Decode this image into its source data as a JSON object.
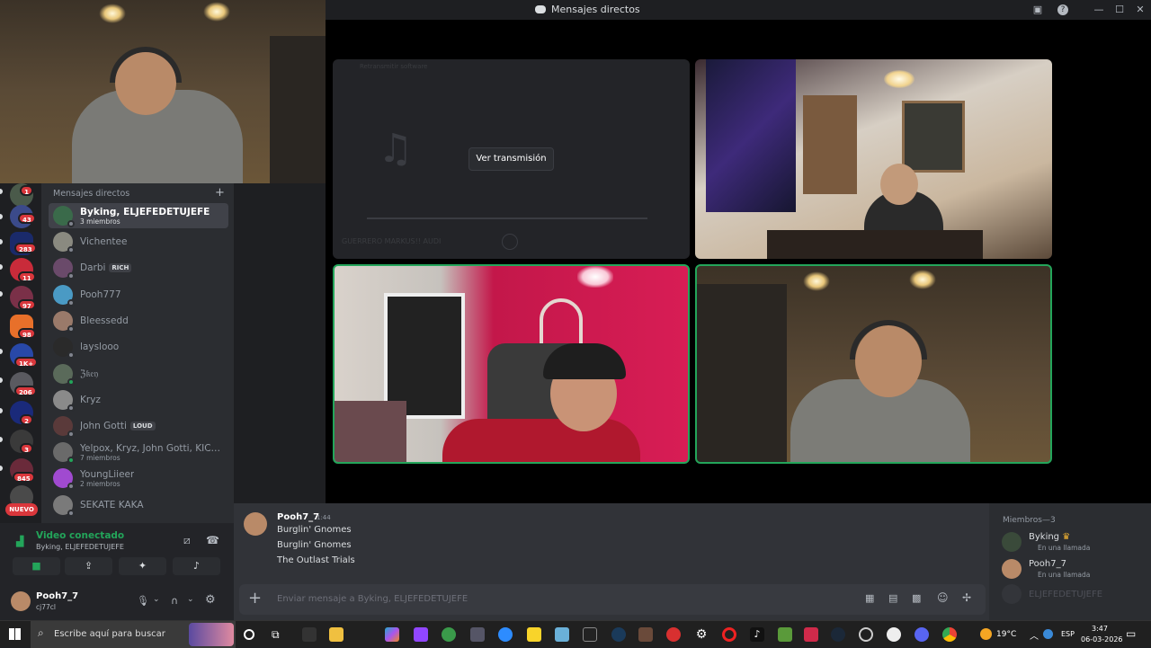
{
  "window": {
    "title": "Mensajes directos"
  },
  "stage": {
    "stream_button": "Ver transmisión",
    "stream_track": "GUERRERO MARKUS!! AUDI",
    "stream_channel": "Retransmitir software"
  },
  "servers": {
    "badges": [
      "1",
      "43",
      "283",
      "11",
      "97",
      "98",
      "1K+",
      "206",
      "2",
      "3",
      "845"
    ],
    "new_label": "NUEVO"
  },
  "dm": {
    "header": "Mensajes directos",
    "items": [
      {
        "name": "Byking, ELJEFEDETUJEFE",
        "sub": "3 miembros",
        "active": true
      },
      {
        "name": "Vichentee"
      },
      {
        "name": "Darbi",
        "tag": "RICH"
      },
      {
        "name": "Pooh777"
      },
      {
        "name": "Bleessedd"
      },
      {
        "name": "layslooo"
      },
      {
        "name": "ℨ𝔨𝔢𝔶"
      },
      {
        "name": "Kryz"
      },
      {
        "name": "John Gotti",
        "tag": "LOUD"
      },
      {
        "name": "Yelpox, Kryz, John Gotti, KICK BE...",
        "sub": "7 miembros"
      },
      {
        "name": "YoungLiieer",
        "sub": "2 miembros"
      },
      {
        "name": "SEKATE KAKA"
      }
    ]
  },
  "voice": {
    "status": "Video conectado",
    "channel": "Byking, ELJEFEDETUJEFE"
  },
  "user": {
    "name": "Pooh7_7",
    "tag": "cj77cl"
  },
  "chat": {
    "author": "Pooh7_7",
    "time": "1:44",
    "messages": [
      "Burglin' Gnomes",
      "Burglin' Gnomes",
      "The Outlast Trials"
    ],
    "placeholder": "Enviar mensaje a Byking, ELJEFEDETUJEFE"
  },
  "members": {
    "header": "Miembros—3",
    "list": [
      {
        "name": "Byking",
        "status": "En una llamada"
      },
      {
        "name": "Pooh7_7",
        "status": "En una llamada"
      },
      {
        "name": "ELJEFEDETUJEFE"
      }
    ]
  },
  "taskbar": {
    "search_placeholder": "Escribe aquí para buscar",
    "weather": "19°C",
    "lang": "ESP",
    "time": "3:47",
    "date": "06-03-2026"
  },
  "colors": {
    "accent_green": "#23a55a",
    "badge_red": "#da373c",
    "bg_dark": "#1e1f22"
  }
}
